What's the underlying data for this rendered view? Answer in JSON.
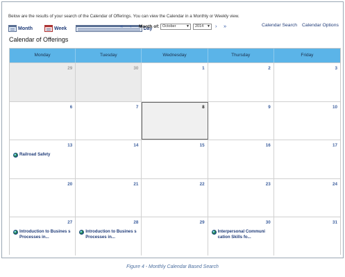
{
  "intro_text": "Below are the results of your search of the Calendar of Offerings. You can view the Calendar in a Monthly or Weekly view.",
  "views": {
    "month": "Month",
    "week": "Week",
    "day": "Day"
  },
  "nav": {
    "month_of_label": "Month of:",
    "month_value": "October",
    "year_value": "2014",
    "first_icon": "double-left-arrow",
    "prev_icon": "left-arrow",
    "next_icon": "right-arrow",
    "last_icon": "double-right-arrow"
  },
  "links": {
    "calendar_search": "Calendar Search",
    "calendar_options": "Calendar Options"
  },
  "title": "Calendar of Offerings",
  "weekdays": [
    "Monday",
    "Tuesday",
    "Wednesday",
    "Thursday",
    "Friday"
  ],
  "weeks": [
    [
      {
        "day": "29",
        "other": true
      },
      {
        "day": "30",
        "other": true
      },
      {
        "day": "1"
      },
      {
        "day": "2"
      },
      {
        "day": "3"
      }
    ],
    [
      {
        "day": "6"
      },
      {
        "day": "7"
      },
      {
        "day": "8",
        "today": true
      },
      {
        "day": "9"
      },
      {
        "day": "10"
      }
    ],
    [
      {
        "day": "13",
        "event": "Railroad Safety"
      },
      {
        "day": "14"
      },
      {
        "day": "15"
      },
      {
        "day": "16"
      },
      {
        "day": "17"
      }
    ],
    [
      {
        "day": "20"
      },
      {
        "day": "21"
      },
      {
        "day": "22"
      },
      {
        "day": "23"
      },
      {
        "day": "24"
      }
    ],
    [
      {
        "day": "27",
        "event": "Introduction to Busines s Processes in..."
      },
      {
        "day": "28",
        "event": "Introduction to Busines s Processes in..."
      },
      {
        "day": "29"
      },
      {
        "day": "30",
        "event": "Interpersonal Communi cation Skills fo..."
      },
      {
        "day": "31"
      }
    ]
  ],
  "event_icon": "globe-icon",
  "caption": "Figure 4 - Monthly Calendar Based Search",
  "colors": {
    "header_bg": "#5bb4e8",
    "link": "#1f3b78",
    "other_month_bg": "#ebebeb"
  }
}
